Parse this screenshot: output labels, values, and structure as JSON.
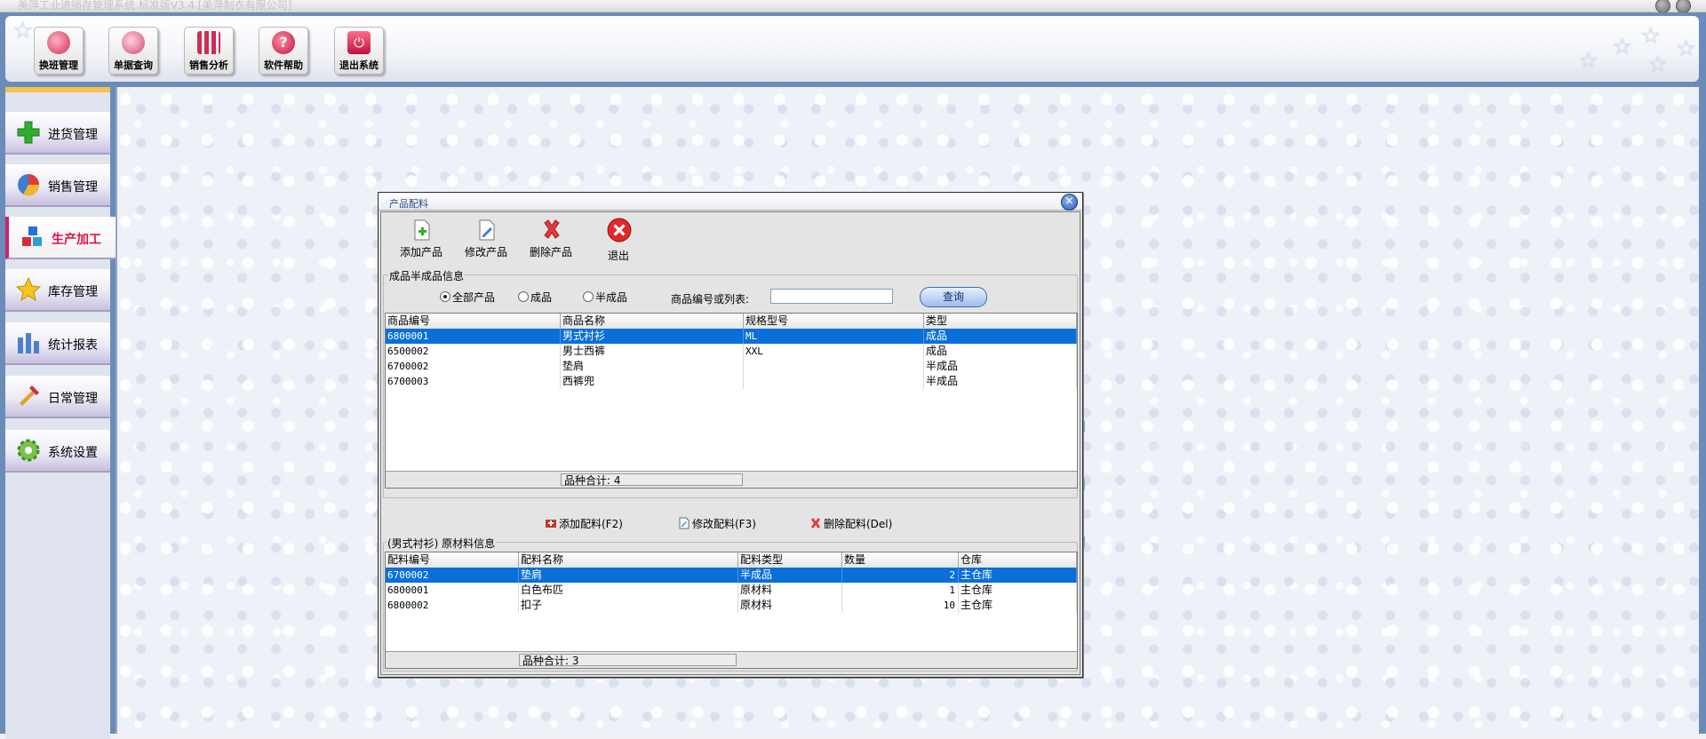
{
  "window": {
    "title": "美萍工业进销存管理系统 标准版V3.4 [美萍制衣有限公司]"
  },
  "toolbar": {
    "buttons": [
      {
        "label": "换班管理",
        "icon": "shift-change-icon"
      },
      {
        "label": "单据查询",
        "icon": "magnifier-icon"
      },
      {
        "label": "销售分析",
        "icon": "bar-chart-icon"
      },
      {
        "label": "软件帮助",
        "icon": "help-icon"
      },
      {
        "label": "退出系统",
        "icon": "power-icon"
      }
    ]
  },
  "sidebar": {
    "items": [
      {
        "label": "进货管理",
        "icon": "plus-icon",
        "active": false
      },
      {
        "label": "销售管理",
        "icon": "pie-icon",
        "active": false
      },
      {
        "label": "生产加工",
        "icon": "cubes-icon",
        "active": true
      },
      {
        "label": "库存管理",
        "icon": "star-icon",
        "active": false
      },
      {
        "label": "统计报表",
        "icon": "report-bars-icon",
        "active": false
      },
      {
        "label": "日常管理",
        "icon": "tools-icon",
        "active": false
      },
      {
        "label": "系统设置",
        "icon": "gear-icon",
        "active": false
      }
    ]
  },
  "dialog": {
    "title": "产品配料",
    "toolbar": {
      "add_product": "添加产品",
      "edit_product": "修改产品",
      "delete_product": "删除产品",
      "exit": "退出"
    },
    "product_group": {
      "legend": "成品半成品信息",
      "radios": {
        "all": "全部产品",
        "finished": "成品",
        "semi": "半成品",
        "selected": "all"
      },
      "search_label": "商品编号或列表:",
      "search_value": "",
      "query_button": "查询"
    },
    "product_table": {
      "columns": [
        "商品编号",
        "商品名称",
        "规格型号",
        "类型"
      ],
      "rows": [
        [
          "6800001",
          "男式衬衫",
          "ML",
          "成品"
        ],
        [
          "6500002",
          "男士西裤",
          "XXL",
          "成品"
        ],
        [
          "6700002",
          "垫肩",
          "",
          "半成品"
        ],
        [
          "6700003",
          "西裤兜",
          "",
          "半成品"
        ]
      ],
      "selected_row": 0,
      "footer": "品种合计: 4"
    },
    "material_actions": {
      "add": "添加配料(F2)",
      "edit": "修改配料(F3)",
      "delete": "删除配料(Del)"
    },
    "material_group": {
      "legend": "(男式衬衫) 原材料信息"
    },
    "material_table": {
      "columns": [
        "配料编号",
        "配料名称",
        "配料类型",
        "数量",
        "仓库"
      ],
      "rows": [
        [
          "6700002",
          "垫肩",
          "半成品",
          "2",
          "主仓库"
        ],
        [
          "6800001",
          "白色布匹",
          "原材料",
          "1",
          "主仓库"
        ],
        [
          "6800002",
          "扣子",
          "原材料",
          "10",
          "主仓库"
        ]
      ],
      "selected_row": 0,
      "footer": "品种合计: 3"
    }
  },
  "colors": {
    "frame_blue": "#6a8cb8",
    "selection_blue": "#0a6fd8",
    "active_menu_red": "#e0124a",
    "accent_yellow": "#f6c04a"
  }
}
